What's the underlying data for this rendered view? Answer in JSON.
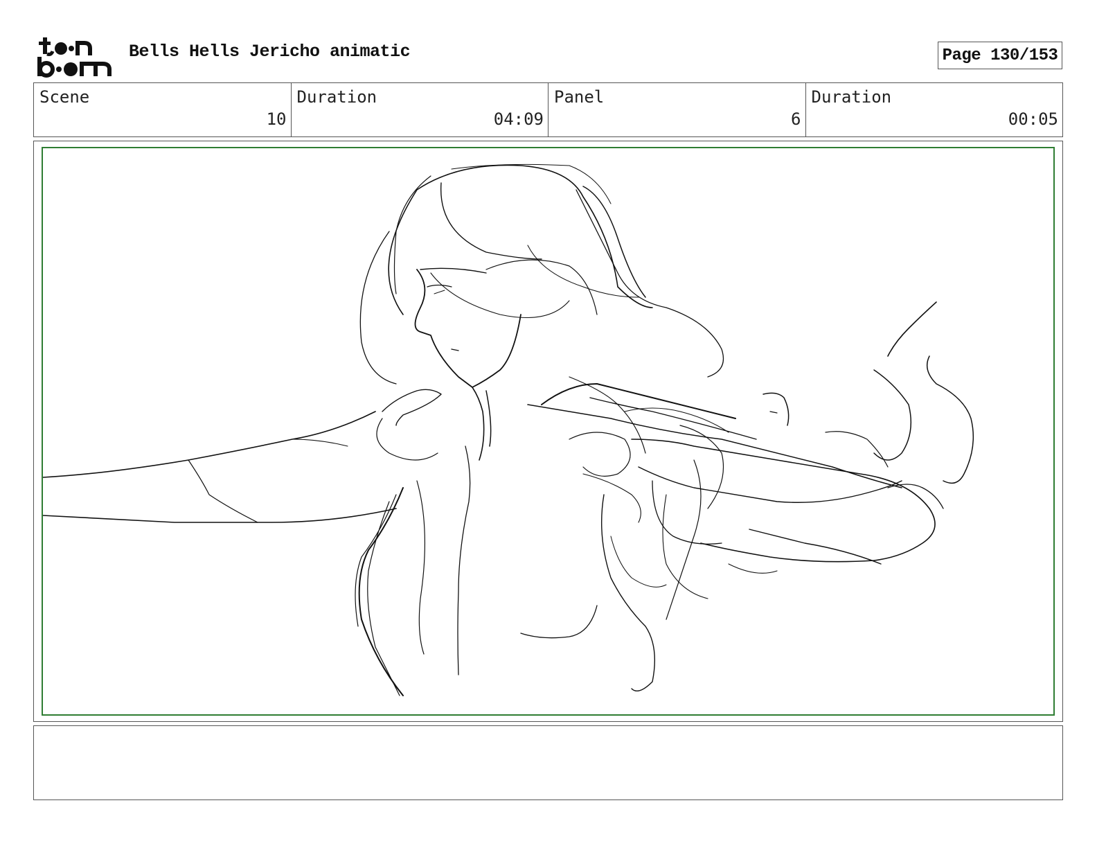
{
  "logo": {
    "line1": "toon",
    "line2": "boom"
  },
  "header": {
    "title": "Bells Hells Jericho animatic",
    "page_label": "Page 130/153"
  },
  "info": {
    "scene_label": "Scene",
    "scene_value": "10",
    "duration_label": "Duration",
    "duration_value": "04:09",
    "panel_label": "Panel",
    "panel_value": "6",
    "panel_duration_label": "Duration",
    "panel_duration_value": "00:05"
  },
  "panel": {
    "frame_color": "#2e7d32",
    "sketch_color": "#111111"
  },
  "notes": {
    "text": ""
  }
}
